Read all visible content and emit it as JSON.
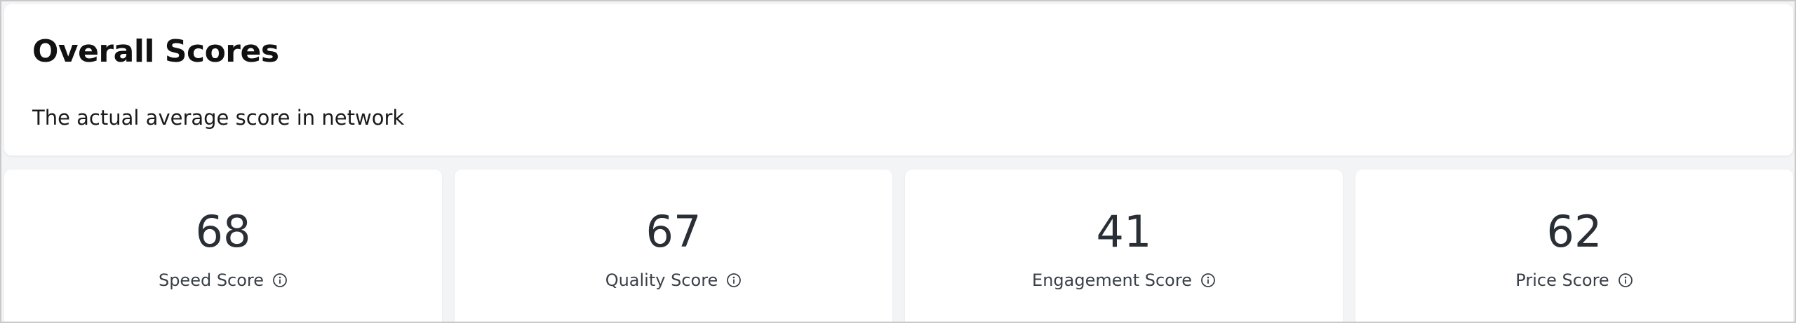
{
  "header": {
    "title": "Overall Scores",
    "subtitle": "The actual average score in network"
  },
  "scores": [
    {
      "value": "68",
      "label": "Speed Score",
      "icon": "info-icon"
    },
    {
      "value": "67",
      "label": "Quality Score",
      "icon": "info-icon"
    },
    {
      "value": "41",
      "label": "Engagement Score",
      "icon": "info-icon"
    },
    {
      "value": "62",
      "label": "Price Score",
      "icon": "info-icon"
    }
  ],
  "colors": {
    "background": "#f3f4f6",
    "card": "#ffffff",
    "title": "#111111",
    "value": "#2a2e35",
    "label": "#3b4048"
  }
}
